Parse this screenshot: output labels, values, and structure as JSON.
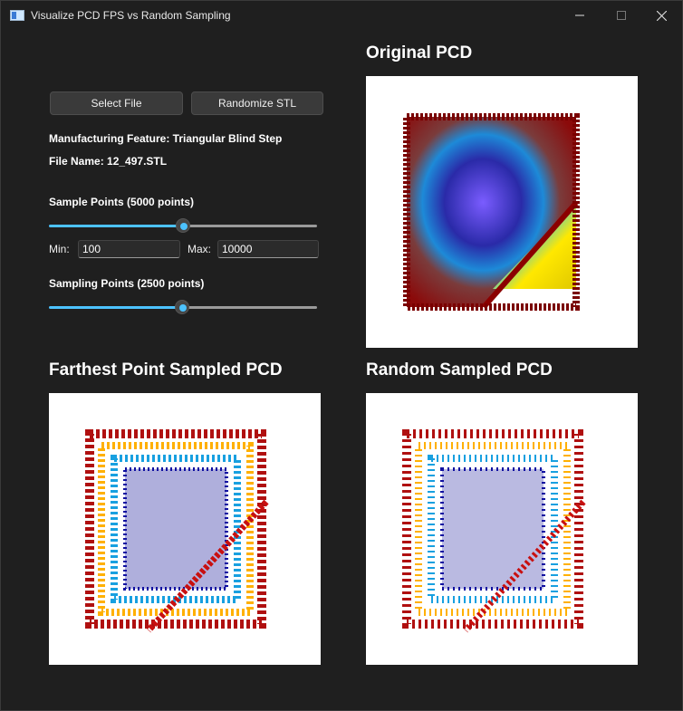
{
  "window": {
    "title": "Visualize PCD FPS vs Random Sampling",
    "minimize_icon": "minimize-icon",
    "maximize_icon": "maximize-icon",
    "close_icon": "close-icon"
  },
  "controls": {
    "select_file_label": "Select File",
    "randomize_label": "Randomize STL",
    "feature_text": "Manufacturing Feature: Triangular Blind Step",
    "file_name_text": "File Name: 12_497.STL",
    "sample_points_label": "Sample Points (5000 points)",
    "sample_points_value": 5000,
    "min_label": "Min:",
    "min_value": "100",
    "max_label": "Max:",
    "max_value": "10000",
    "sampling_points_label": "Sampling Points (2500 points)",
    "sampling_points_value": 2500,
    "sample_slider_fraction": 0.5,
    "sampling_slider_fraction": 0.5
  },
  "panels": {
    "original_title": "Original PCD",
    "fps_title": "Farthest Point Sampled PCD",
    "random_title": "Random Sampled PCD"
  },
  "colors": {
    "accent": "#4cc2ff",
    "background": "#1f1f1f"
  }
}
